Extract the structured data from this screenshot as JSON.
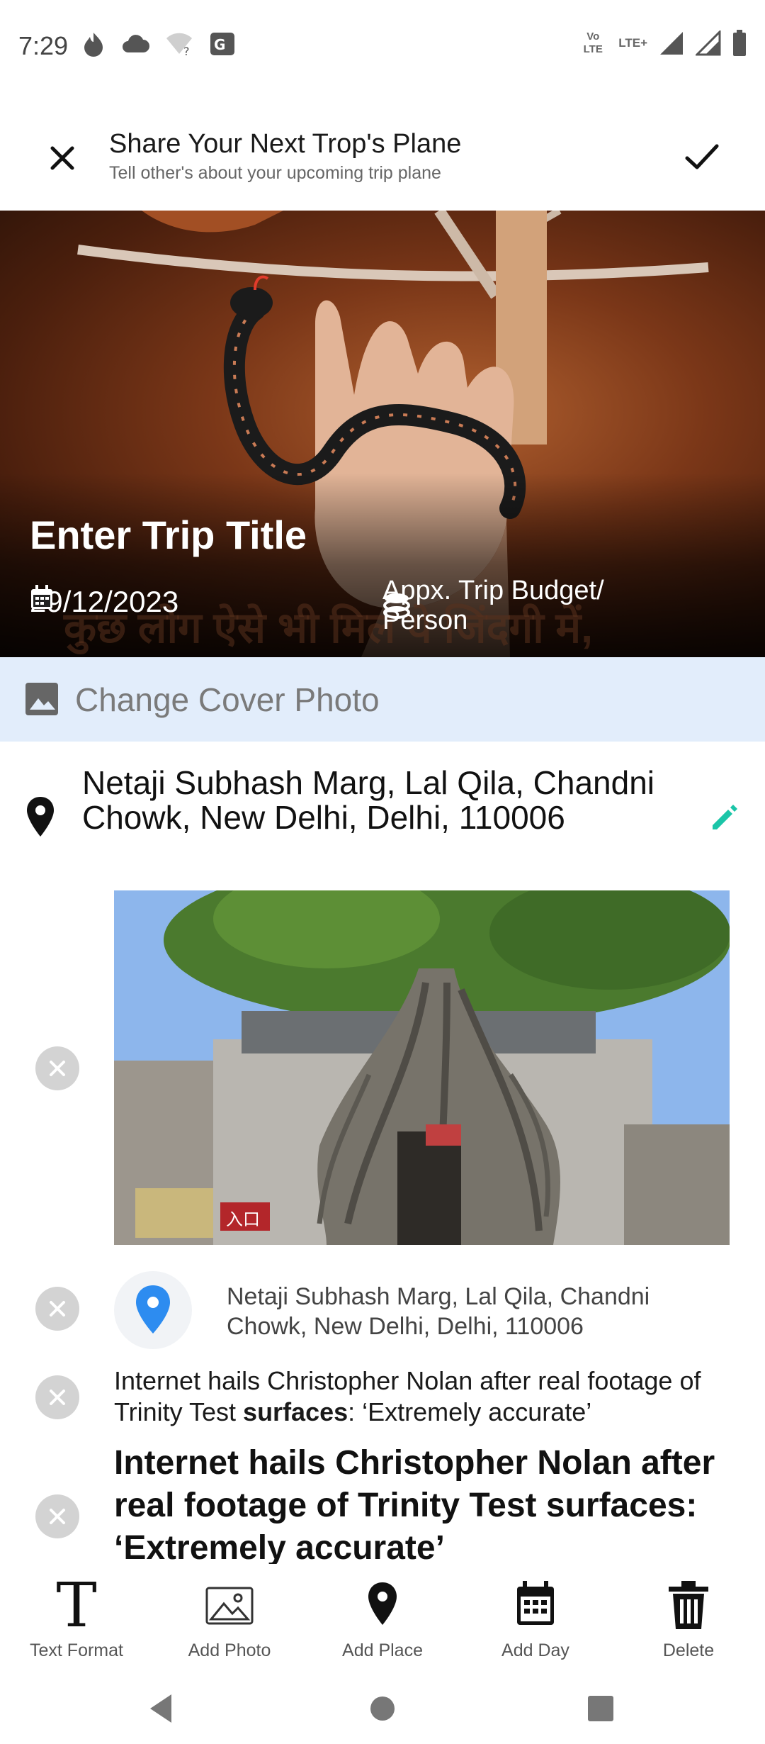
{
  "status_bar": {
    "time": "7:29",
    "right_text_1": "Vo LTE",
    "right_text_2": "LTE+",
    "icons": [
      "flame-icon",
      "cloud-icon",
      "wifi-question-icon",
      "translate-icon",
      "signal-icon",
      "battery-icon"
    ]
  },
  "app_bar": {
    "title": "Share Your Next Trop's Plane",
    "subtitle": "Tell other's about your upcoming trip plane",
    "close_icon": "close-icon",
    "confirm_icon": "check-icon"
  },
  "cover": {
    "title_placeholder": "Enter Trip Title",
    "date": "29/12/2023",
    "budget_placeholder": "Appx. Trip Budget/ Person",
    "caption_text": "कुछ लोग ऐसे भी मिल ये जिंदगी में,"
  },
  "change_cover": {
    "label": "Change Cover Photo"
  },
  "location": {
    "address": "Netaji Subhash Marg, Lal Qila, Chandni Chowk, New Delhi, Delhi, 110006"
  },
  "items": {
    "place_address": "Netaji Subhash Marg, Lal Qila, Chandni Chowk, New Delhi, Delhi, 110006",
    "text_before": "Internet hails Christopher Nolan after real footage of Trinity Test ",
    "text_bold": "surfaces",
    "text_after": ": ‘Extremely accurate’",
    "heading": "Internet hails Christopher Nolan after real footage of Trinity Test surfaces: ‘Extremely accurate’",
    "photo_sign_text": "入口"
  },
  "toolbar": {
    "text_format": "Text Format",
    "add_photo": "Add Photo",
    "add_place": "Add Place",
    "add_day": "Add Day",
    "delete": "Delete"
  },
  "colors": {
    "accent_teal": "#1bc5a8",
    "pin_blue": "#2d8cf0",
    "cover_banner_bg": "#e2edfb"
  }
}
